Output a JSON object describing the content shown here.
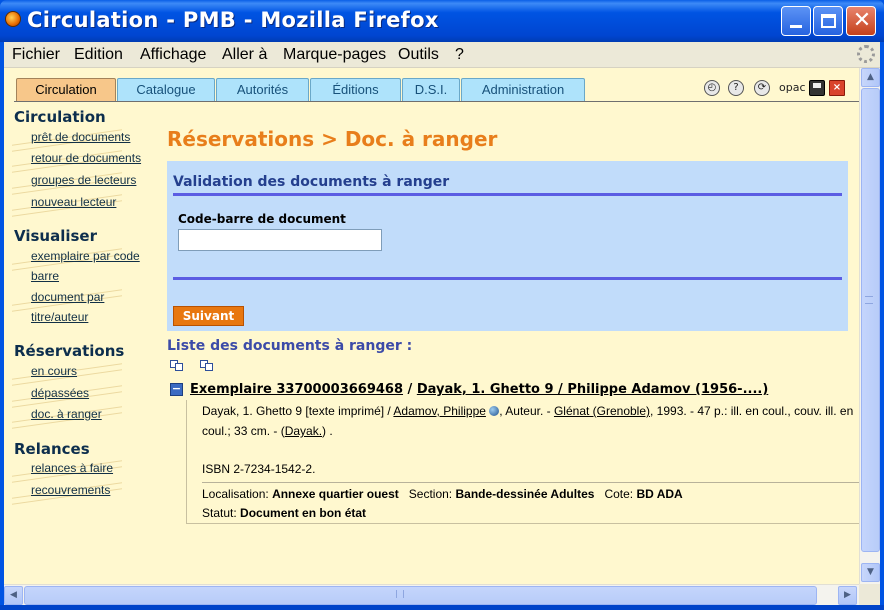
{
  "window": {
    "title": "Circulation - PMB - Mozilla Firefox"
  },
  "menubar": {
    "items": [
      "Fichier",
      "Edition",
      "Affichage",
      "Aller à",
      "Marque-pages",
      "Outils",
      "?"
    ]
  },
  "tabs": [
    "Circulation",
    "Catalogue",
    "Autorités",
    "Éditions",
    "D.S.I.",
    "Administration"
  ],
  "active_tab": "Circulation",
  "toolbar_icons": {
    "opac_label": "opac",
    "help_glyph": "?",
    "quit_glyph": "×"
  },
  "nav": {
    "sections": [
      {
        "heading": "Circulation",
        "links": [
          "prêt de documents",
          "retour de documents",
          "groupes de lecteurs",
          "nouveau lecteur"
        ]
      },
      {
        "heading": "Visualiser",
        "links": [
          "exemplaire par code",
          "barre",
          "document par",
          "titre/auteur"
        ]
      },
      {
        "heading": "Réservations",
        "links": [
          "en cours",
          "dépassées",
          "doc. à ranger"
        ]
      },
      {
        "heading": "Relances",
        "links": [
          "relances à faire",
          "recouvrements"
        ]
      }
    ]
  },
  "main": {
    "page_title": "Réservations > Doc. à ranger",
    "form": {
      "title": "Validation des documents à ranger",
      "barcode_label": "Code-barre de document",
      "barcode_value": "",
      "submit_label": "Suivant"
    },
    "list_title": "Liste des documents à ranger :",
    "record": {
      "toggle": "−",
      "exemplaire_link": "Exemplaire 33700003669468",
      "separator": " / ",
      "title_link": "Dayak, 1. Ghetto 9 / Philippe Adamov (1956-....)",
      "line1_prefix": "Dayak, 1. Ghetto 9 [texte imprimé] / ",
      "author_link": "Adamov, Philippe",
      "line1_role": ", Auteur. - ",
      "publisher_link": "Glénat (Grenoble)",
      "line1_suffix": ", 1993. - 47 p.: ill. en coul., couv. ill. en",
      "line2_prefix": "coul.; 33 cm. - (",
      "series_link": "Dayak.",
      "line2_suffix": ") .",
      "isbn": "ISBN 2-7234-1542-2.",
      "location_label": "Localisation:",
      "location_value": "Annexe quartier ouest",
      "section_label": "Section:",
      "section_value": "Bande-dessinée Adultes",
      "cote_label": "Cote:",
      "cote_value": "BD ADA",
      "status_label": "Statut:",
      "status_value": "Document en bon état"
    }
  }
}
